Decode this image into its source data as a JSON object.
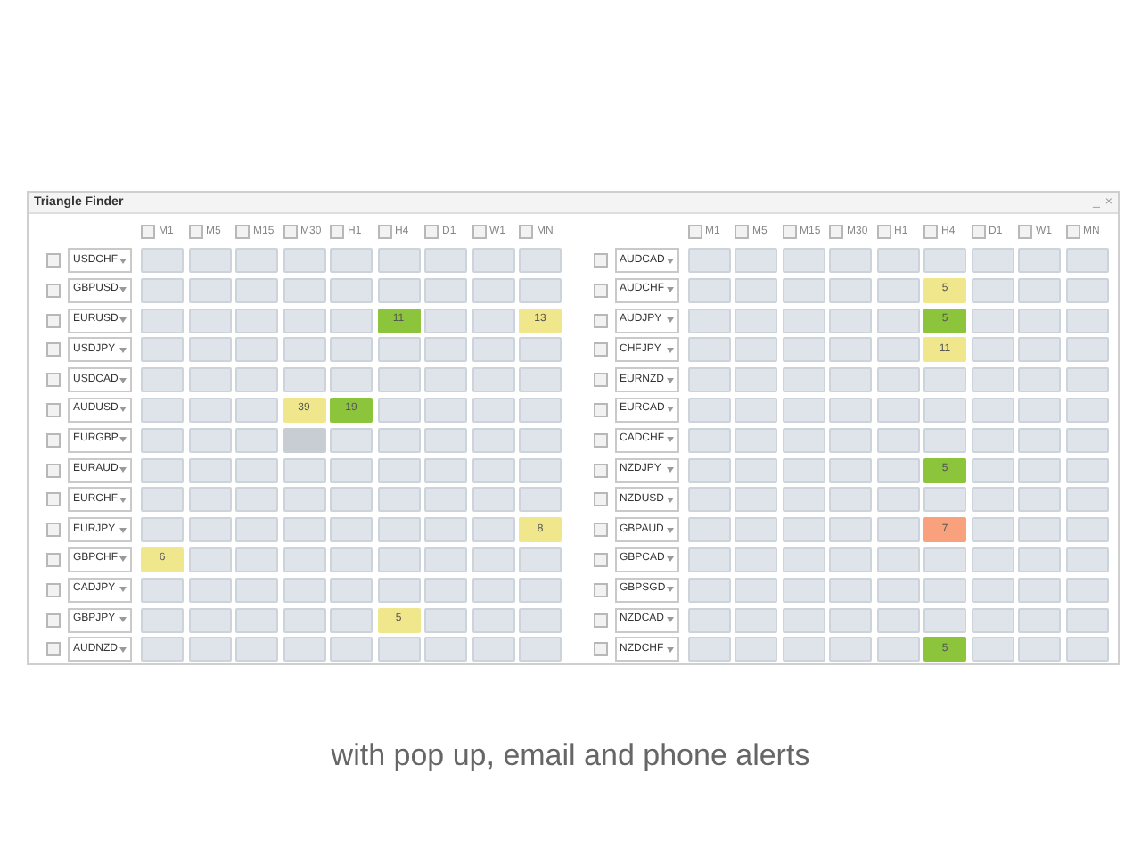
{
  "window": {
    "title": "Triangle Finder",
    "controls": [
      "_",
      "×"
    ]
  },
  "panels": [
    {
      "timeframes": [
        {
          "label": "M1",
          "checked": false
        },
        {
          "label": "M5",
          "checked": false
        },
        {
          "label": "M15",
          "checked": false
        },
        {
          "label": "M30",
          "checked": false
        },
        {
          "label": "H1",
          "checked": false
        },
        {
          "label": "H4",
          "checked": false
        },
        {
          "label": "D1",
          "checked": false
        },
        {
          "label": "W1",
          "checked": false
        },
        {
          "label": "MN",
          "checked": false
        }
      ],
      "rows": [
        {
          "symbol": "USDCHF",
          "checked": false,
          "cells": [
            null,
            null,
            null,
            null,
            null,
            null,
            null,
            null,
            null
          ]
        },
        {
          "symbol": "GBPUSD",
          "checked": false,
          "cells": [
            null,
            null,
            null,
            null,
            null,
            null,
            null,
            null,
            null
          ]
        },
        {
          "symbol": "EURUSD",
          "checked": false,
          "cells": [
            null,
            null,
            null,
            null,
            null,
            {
              "value": "11",
              "color": "#8cc43c"
            },
            null,
            null,
            {
              "value": "13",
              "color": "#f0e68c"
            }
          ]
        },
        {
          "symbol": "USDJPY",
          "checked": false,
          "cells": [
            null,
            null,
            null,
            null,
            null,
            null,
            null,
            null,
            null
          ]
        },
        {
          "symbol": "USDCAD",
          "checked": false,
          "cells": [
            null,
            null,
            null,
            null,
            null,
            null,
            null,
            null,
            null
          ]
        },
        {
          "symbol": "AUDUSD",
          "checked": false,
          "cells": [
            null,
            null,
            null,
            {
              "value": "39",
              "color": "#f0e68c"
            },
            {
              "value": "19",
              "color": "#8cc43c"
            },
            null,
            null,
            null,
            null
          ]
        },
        {
          "symbol": "EURGBP",
          "checked": false,
          "cells": [
            null,
            null,
            null,
            {
              "color": "#c8ccd3"
            },
            null,
            null,
            null,
            null,
            null
          ]
        },
        {
          "symbol": "EURAUD",
          "checked": false,
          "cells": [
            null,
            null,
            null,
            null,
            null,
            null,
            null,
            null,
            null
          ]
        },
        {
          "symbol": "EURCHF",
          "checked": false,
          "cells": [
            null,
            null,
            null,
            null,
            null,
            null,
            null,
            null,
            null
          ]
        },
        {
          "symbol": "EURJPY",
          "checked": false,
          "cells": [
            null,
            null,
            null,
            null,
            null,
            null,
            null,
            null,
            {
              "value": "8",
              "color": "#f0e68c"
            }
          ]
        },
        {
          "symbol": "GBPCHF",
          "checked": false,
          "cells": [
            {
              "value": "6",
              "color": "#f0e68c"
            },
            null,
            null,
            null,
            null,
            null,
            null,
            null,
            null
          ]
        },
        {
          "symbol": "CADJPY",
          "checked": false,
          "cells": [
            null,
            null,
            null,
            null,
            null,
            null,
            null,
            null,
            null
          ]
        },
        {
          "symbol": "GBPJPY",
          "checked": false,
          "cells": [
            null,
            null,
            null,
            null,
            null,
            {
              "value": "5",
              "color": "#f0e68c"
            },
            null,
            null,
            null
          ]
        },
        {
          "symbol": "AUDNZD",
          "checked": false,
          "cells": [
            null,
            null,
            null,
            null,
            null,
            null,
            null,
            null,
            null
          ]
        }
      ]
    },
    {
      "timeframes": [
        {
          "label": "M1",
          "checked": false
        },
        {
          "label": "M5",
          "checked": false
        },
        {
          "label": "M15",
          "checked": false
        },
        {
          "label": "M30",
          "checked": false
        },
        {
          "label": "H1",
          "checked": false
        },
        {
          "label": "H4",
          "checked": false
        },
        {
          "label": "D1",
          "checked": false
        },
        {
          "label": "W1",
          "checked": false
        },
        {
          "label": "MN",
          "checked": false
        }
      ],
      "rows": [
        {
          "symbol": "AUDCAD",
          "checked": false,
          "cells": [
            null,
            null,
            null,
            null,
            null,
            null,
            null,
            null,
            null
          ]
        },
        {
          "symbol": "AUDCHF",
          "checked": false,
          "cells": [
            null,
            null,
            null,
            null,
            null,
            {
              "value": "5",
              "color": "#f0e68c"
            },
            null,
            null,
            null
          ]
        },
        {
          "symbol": "AUDJPY",
          "checked": false,
          "cells": [
            null,
            null,
            null,
            null,
            null,
            {
              "value": "5",
              "color": "#8cc43c"
            },
            null,
            null,
            null
          ]
        },
        {
          "symbol": "CHFJPY",
          "checked": false,
          "cells": [
            null,
            null,
            null,
            null,
            null,
            {
              "value": "11",
              "color": "#f0e68c"
            },
            null,
            null,
            null
          ]
        },
        {
          "symbol": "EURNZD",
          "checked": false,
          "cells": [
            null,
            null,
            null,
            null,
            null,
            null,
            null,
            null,
            null
          ]
        },
        {
          "symbol": "EURCAD",
          "checked": false,
          "cells": [
            null,
            null,
            null,
            null,
            null,
            null,
            null,
            null,
            null
          ]
        },
        {
          "symbol": "CADCHF",
          "checked": false,
          "cells": [
            null,
            null,
            null,
            null,
            null,
            null,
            null,
            null,
            null
          ]
        },
        {
          "symbol": "NZDJPY",
          "checked": false,
          "cells": [
            null,
            null,
            null,
            null,
            null,
            {
              "value": "5",
              "color": "#8cc43c"
            },
            null,
            null,
            null
          ]
        },
        {
          "symbol": "NZDUSD",
          "checked": false,
          "cells": [
            null,
            null,
            null,
            null,
            null,
            null,
            null,
            null,
            null
          ]
        },
        {
          "symbol": "GBPAUD",
          "checked": false,
          "cells": [
            null,
            null,
            null,
            null,
            null,
            {
              "value": "7",
              "color": "#f9a07c"
            },
            null,
            null,
            null
          ]
        },
        {
          "symbol": "GBPCAD",
          "checked": false,
          "cells": [
            null,
            null,
            null,
            null,
            null,
            null,
            null,
            null,
            null
          ]
        },
        {
          "symbol": "GBPSGD",
          "checked": false,
          "cells": [
            null,
            null,
            null,
            null,
            null,
            null,
            null,
            null,
            null
          ]
        },
        {
          "symbol": "NZDCAD",
          "checked": false,
          "cells": [
            null,
            null,
            null,
            null,
            null,
            null,
            null,
            null,
            null
          ]
        },
        {
          "symbol": "NZDCHF",
          "checked": false,
          "cells": [
            null,
            null,
            null,
            null,
            null,
            {
              "value": "5",
              "color": "#8cc43c"
            },
            null,
            null,
            null
          ]
        }
      ]
    }
  ],
  "caption": "with pop up, email and phone alerts"
}
